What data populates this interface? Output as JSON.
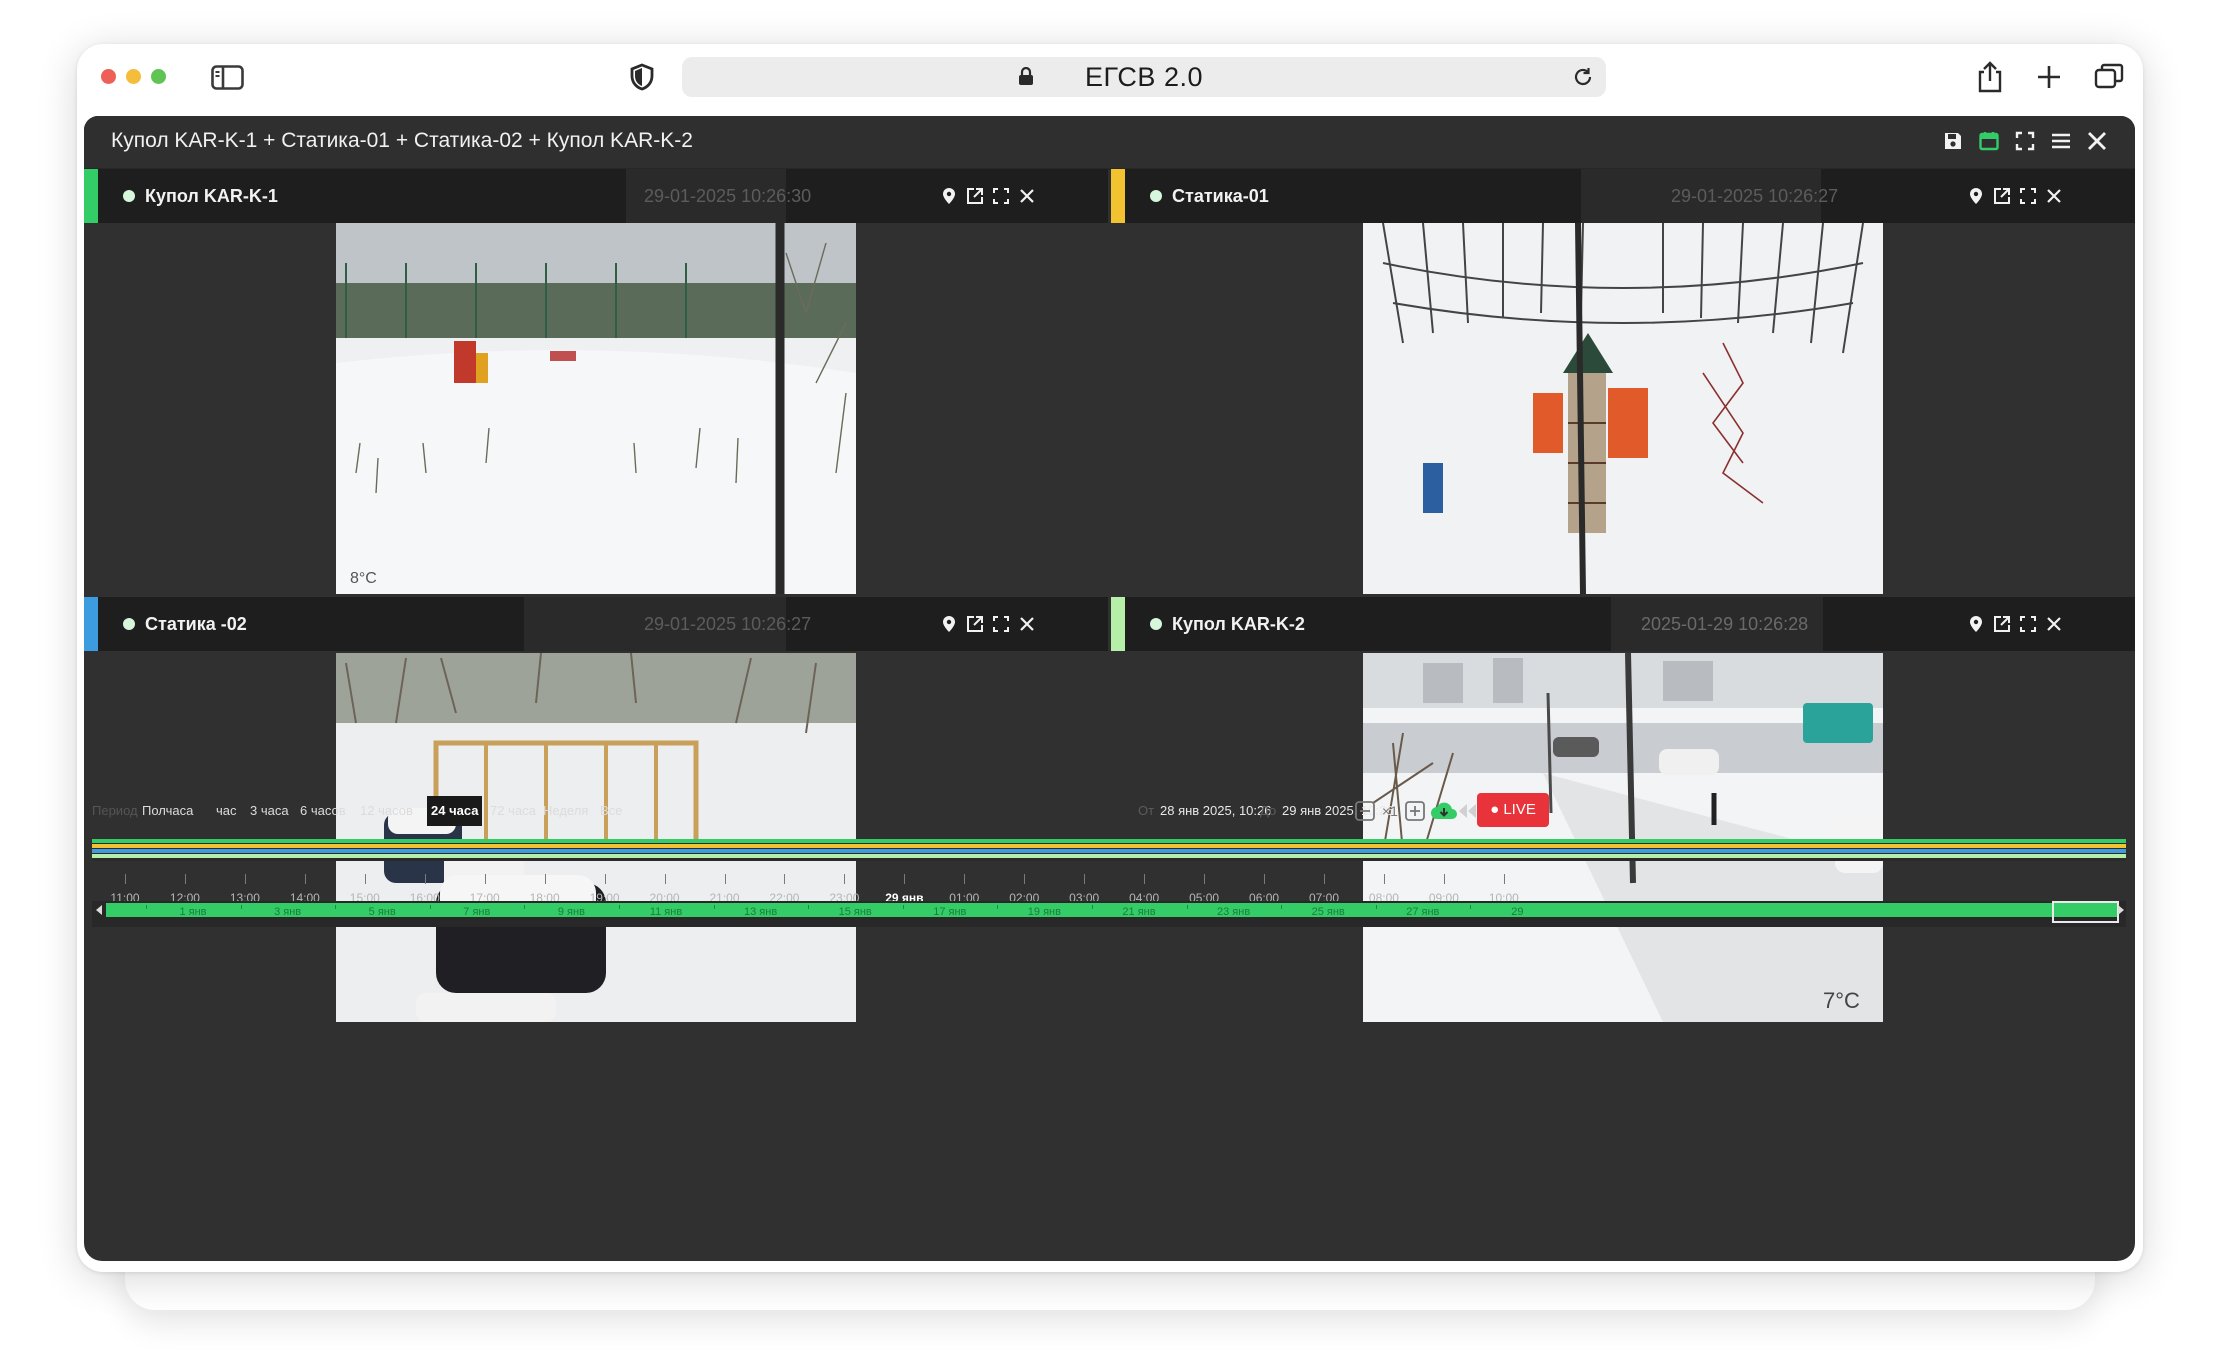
{
  "browser": {
    "url_text": "ЕГСВ 2.0",
    "icons": [
      "sidebar-icon",
      "shield-icon",
      "lock-icon",
      "reload-icon",
      "share-icon",
      "new-tab-icon",
      "tabs-overview-icon"
    ]
  },
  "app": {
    "title": "Купол KAR-K-1 + Статика-01 + Статика-02 + Купол KAR-K-2",
    "header_icons": [
      "save-icon",
      "calendar-icon",
      "fullscreen-icon",
      "menu-icon",
      "close-icon"
    ]
  },
  "cameras": [
    {
      "name": "Купол KAR-K-1",
      "timestamp": "29-01-2025 10:26:30",
      "accent": "#33cc66",
      "overlay": "8°C"
    },
    {
      "name": "Статика-01",
      "timestamp": "29-01-2025 10:26:27",
      "accent": "#f2c230",
      "overlay": ""
    },
    {
      "name": "Статика -02",
      "timestamp": "29-01-2025 10:26:27",
      "accent": "#3d9be0",
      "overlay": ""
    },
    {
      "name": "Купол KAR-K-2",
      "timestamp": "2025-01-29 10:26:28",
      "accent": "#b6f0a8",
      "overlay": "7°C"
    }
  ],
  "timeline": {
    "period_label": "Период",
    "period_options": [
      "Полчаса",
      "час",
      "3 часа",
      "6 часов",
      "12 часов",
      "24 часа",
      "72 часа",
      "Неделя",
      "Все"
    ],
    "active_period": "24 часа",
    "from_label": "От",
    "from_value": "28 янв 2025, 10:26",
    "to_label": "До",
    "to_value": "29 янв 2025, 10:26",
    "speed": "×1",
    "live_label": "LIVE",
    "track_colors": [
      "#33cc66",
      "#f2c230",
      "#3d9be0",
      "#b6f0a8"
    ],
    "hour_ticks": [
      "11:00",
      "12:00",
      "13:00",
      "14:00",
      "15:00",
      "16:00",
      "17:00",
      "18:00",
      "19:00",
      "20:00",
      "21:00",
      "22:00",
      "23:00",
      "29 янв",
      "01:00",
      "02:00",
      "03:00",
      "04:00",
      "05:00",
      "06:00",
      "07:00",
      "08:00",
      "09:00",
      "10:00"
    ],
    "overview_labels": [
      "1 янв",
      "3 янв",
      "5 янв",
      "7 янв",
      "9 янв",
      "11 янв",
      "13 янв",
      "15 янв",
      "17 янв",
      "19 янв",
      "21 янв",
      "23 янв",
      "25 янв",
      "27 янв",
      "29"
    ]
  }
}
